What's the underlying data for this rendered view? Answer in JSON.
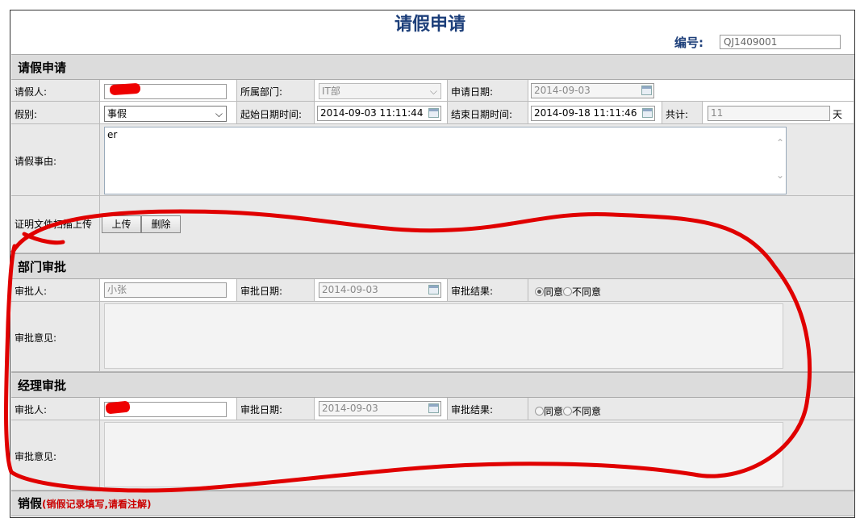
{
  "header": {
    "title": "请假申请",
    "docno_label": "编号:",
    "docno_value": "QJ1409001"
  },
  "leave_section": {
    "heading": "请假申请",
    "applicant_label": "请假人:",
    "dept_label": "所属部门:",
    "dept_value": "IT部",
    "apply_date_label": "申请日期:",
    "apply_date_value": "2014-09-03",
    "type_label": "假别:",
    "type_value": "事假",
    "start_label": "起始日期时间:",
    "start_value": "2014-09-03 11:11:44",
    "end_label": "结束日期时间:",
    "end_value": "2014-09-18 11:11:46",
    "total_label": "共计:",
    "total_value": "11",
    "total_unit": "天",
    "reason_label": "请假事由:",
    "reason_value": "er",
    "upload_label": "证明文件扫描上传",
    "upload_button": "上传",
    "delete_button": "删除"
  },
  "dept_approval": {
    "heading": "部门审批",
    "approver_label": "审批人:",
    "approver_value": "小张",
    "date_label": "审批日期:",
    "date_value": "2014-09-03",
    "result_label": "审批结果:",
    "agree": "同意",
    "disagree": "不同意",
    "agree_checked": true,
    "opinion_label": "审批意见:",
    "opinion_value": ""
  },
  "mgr_approval": {
    "heading": "经理审批",
    "approver_label": "审批人:",
    "date_label": "审批日期:",
    "date_value": "2014-09-03",
    "result_label": "审批结果:",
    "agree": "同意",
    "disagree": "不同意",
    "agree_checked": false,
    "opinion_label": "审批意见:",
    "opinion_value": ""
  },
  "cancel_section": {
    "heading": "销假",
    "note": "(销假记录填写,请看注解)"
  },
  "colors": {
    "title_blue": "#1d3f7a",
    "annotation_red": "#e00000",
    "section_bg": "#dcdcdc",
    "note_red": "#cc0000"
  }
}
